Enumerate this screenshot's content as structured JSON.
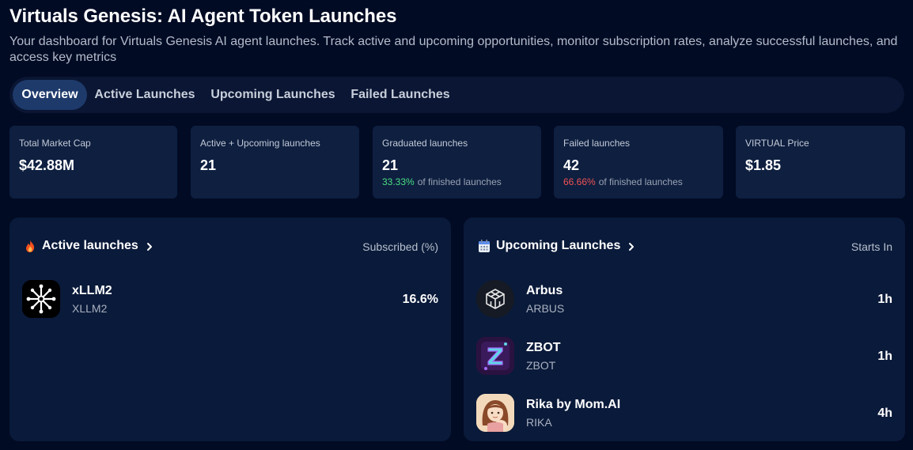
{
  "header": {
    "title": "Virtuals Genesis: AI Agent Token Launches",
    "subtitle": "Your dashboard for Virtuals Genesis AI agent launches. Track active and upcoming opportunities, monitor subscription rates, analyze successful launches, and access key metrics"
  },
  "tabs": [
    {
      "label": "Overview",
      "active": true
    },
    {
      "label": "Active Launches",
      "active": false
    },
    {
      "label": "Upcoming Launches",
      "active": false
    },
    {
      "label": "Failed Launches",
      "active": false
    }
  ],
  "stats": [
    {
      "label": "Total Market Cap",
      "value": "$42.88M"
    },
    {
      "label": "Active + Upcoming launches",
      "value": "21"
    },
    {
      "label": "Graduated launches",
      "value": "21",
      "pct": "33.33%",
      "pct_color": "#4ade80",
      "suffix": "of finished launches"
    },
    {
      "label": "Failed launches",
      "value": "42",
      "pct": "66.66%",
      "pct_color": "#f05252",
      "suffix": "of finished launches"
    },
    {
      "label": "VIRTUAL Price",
      "value": "$1.85"
    }
  ],
  "active_panel": {
    "icon": "fire-icon",
    "title": "Active launches",
    "column_label": "Subscribed (%)",
    "items": [
      {
        "name": "xLLM2",
        "ticker": "XLLM2",
        "value": "16.6%",
        "icon": "xllm2-logo"
      }
    ]
  },
  "upcoming_panel": {
    "icon": "calendar-icon",
    "title": "Upcoming Launches",
    "column_label": "Starts In",
    "items": [
      {
        "name": "Arbus",
        "ticker": "ARBUS",
        "value": "1h",
        "icon": "arbus-logo"
      },
      {
        "name": "ZBOT",
        "ticker": "ZBOT",
        "value": "1h",
        "icon": "zbot-logo"
      },
      {
        "name": "Rika by Mom.AI",
        "ticker": "RIKA",
        "value": "4h",
        "icon": "rika-avatar"
      }
    ]
  }
}
